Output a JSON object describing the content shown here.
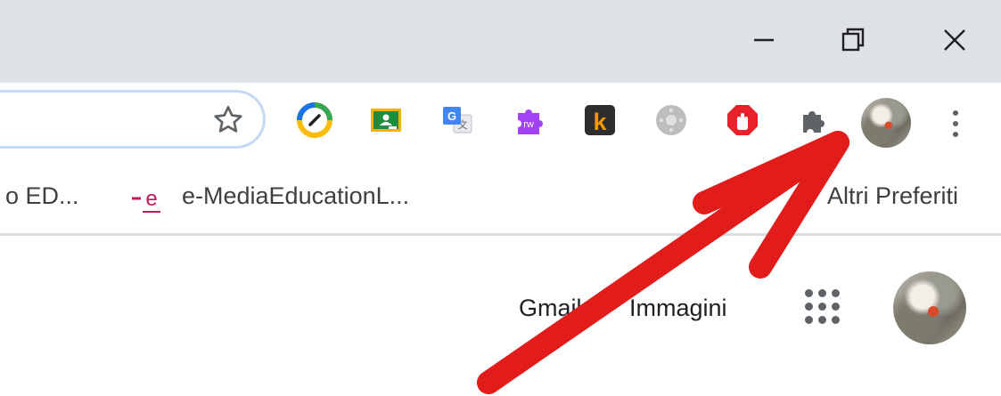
{
  "window_controls": {
    "minimize_icon": "minimize-icon",
    "maximize_icon": "restore-icon",
    "close_icon": "close-icon"
  },
  "toolbar": {
    "star_icon": "star-icon",
    "extensions": [
      "edpuzzle-icon",
      "google-classroom-icon",
      "google-translate-icon",
      "read-write-icon",
      "kami-icon",
      "gray-circle-extension-icon",
      "adblock-icon",
      "extensions-puzzle-icon"
    ],
    "profile_icon": "profile-avatar",
    "menu_icon": "more-vert-icon"
  },
  "bookmarks": {
    "items": [
      {
        "label": "o ED..."
      },
      {
        "label": "e-MediaEducationL..."
      }
    ],
    "other": {
      "label": "Altri Preferiti"
    }
  },
  "page": {
    "gmail_label": "Gmail",
    "images_label": "Immagini",
    "apps_icon": "apps-grid-icon",
    "account_icon": "account-avatar"
  },
  "colors": {
    "titlebar_bg": "#dee1e6",
    "omnibox_border": "#c5d9f6",
    "arrow": "#e21b1b"
  }
}
